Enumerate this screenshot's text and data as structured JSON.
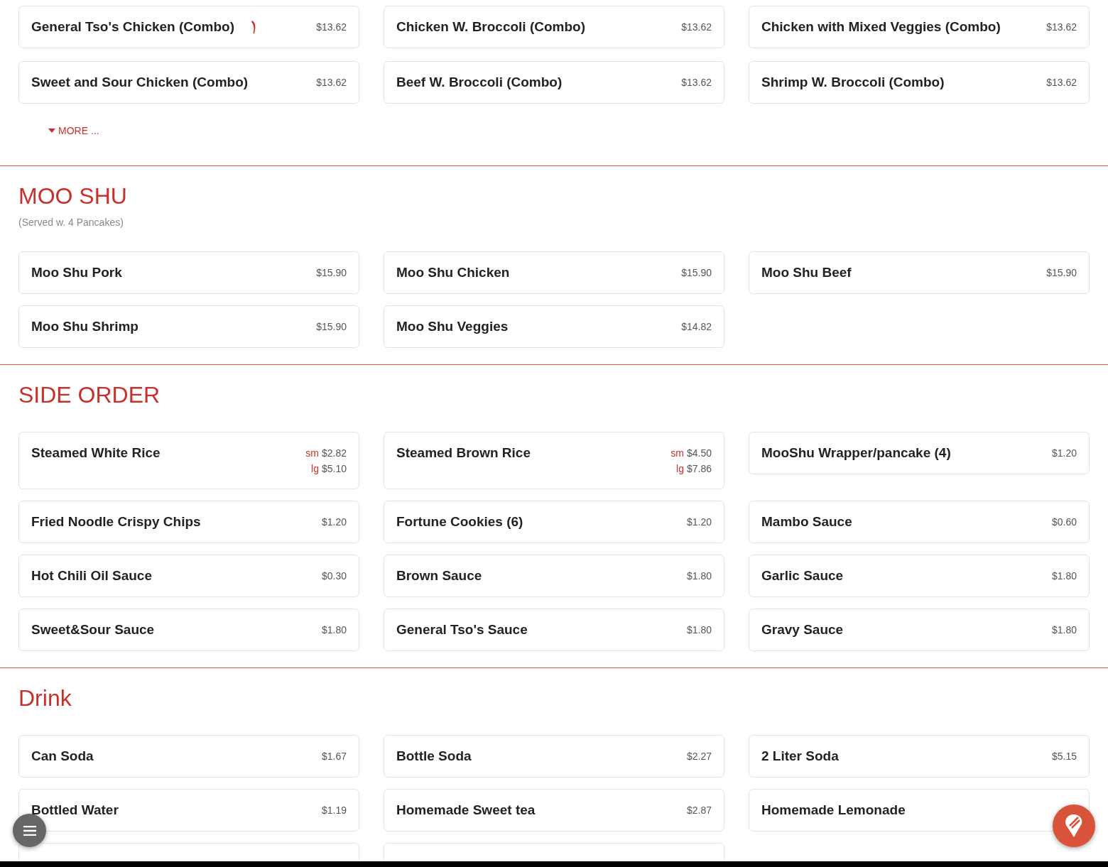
{
  "sections": [
    {
      "items": [
        {
          "name": "General Tso's Chicken (Combo)",
          "spicy": true,
          "prices": [
            {
              "price": "$13.62"
            }
          ]
        },
        {
          "name": "Chicken W. Broccoli (Combo)",
          "spicy": false,
          "prices": [
            {
              "price": "$13.62"
            }
          ]
        },
        {
          "name": "Chicken with Mixed Veggies (Combo)",
          "spicy": false,
          "prices": [
            {
              "price": "$13.62"
            }
          ]
        },
        {
          "name": "Sweet and Sour Chicken (Combo)",
          "spicy": false,
          "prices": [
            {
              "price": "$13.62"
            }
          ]
        },
        {
          "name": "Beef W. Broccoli (Combo)",
          "spicy": false,
          "prices": [
            {
              "price": "$13.62"
            }
          ]
        },
        {
          "name": "Shrimp W. Broccoli (Combo)",
          "spicy": false,
          "prices": [
            {
              "price": "$13.62"
            }
          ]
        }
      ],
      "more": "MORE ..."
    },
    {
      "title": "MOO SHU",
      "subtitle": "(Served w. 4 Pancakes)",
      "items": [
        {
          "name": "Moo Shu Pork",
          "spicy": false,
          "prices": [
            {
              "price": "$15.90"
            }
          ]
        },
        {
          "name": "Moo Shu Chicken",
          "spicy": false,
          "prices": [
            {
              "price": "$15.90"
            }
          ]
        },
        {
          "name": "Moo Shu Beef",
          "spicy": false,
          "prices": [
            {
              "price": "$15.90"
            }
          ]
        },
        {
          "name": "Moo Shu Shrimp",
          "spicy": false,
          "prices": [
            {
              "price": "$15.90"
            }
          ]
        },
        {
          "name": "Moo Shu Veggies",
          "spicy": false,
          "prices": [
            {
              "price": "$14.82"
            }
          ]
        }
      ]
    },
    {
      "title": "SIDE ORDER",
      "items": [
        {
          "name": "Steamed White Rice",
          "spicy": false,
          "prices": [
            {
              "size": "sm",
              "price": "$2.82"
            },
            {
              "size": "lg",
              "price": "$5.10"
            }
          ]
        },
        {
          "name": "Steamed Brown Rice",
          "spicy": false,
          "prices": [
            {
              "size": "sm",
              "price": "$4.50"
            },
            {
              "size": "lg",
              "price": "$7.86"
            }
          ]
        },
        {
          "name": "MooShu Wrapper/pancake (4)",
          "spicy": false,
          "prices": [
            {
              "price": "$1.20"
            }
          ]
        },
        {
          "name": "Fried Noodle Crispy Chips",
          "spicy": false,
          "prices": [
            {
              "price": "$1.20"
            }
          ]
        },
        {
          "name": "Fortune Cookies (6)",
          "spicy": false,
          "prices": [
            {
              "price": "$1.20"
            }
          ]
        },
        {
          "name": "Mambo Sauce",
          "spicy": false,
          "prices": [
            {
              "price": "$0.60"
            }
          ]
        },
        {
          "name": "Hot Chili Oil Sauce",
          "spicy": false,
          "prices": [
            {
              "price": "$0.30"
            }
          ]
        },
        {
          "name": "Brown Sauce",
          "spicy": false,
          "prices": [
            {
              "price": "$1.80"
            }
          ]
        },
        {
          "name": "Garlic Sauce",
          "spicy": false,
          "prices": [
            {
              "price": "$1.80"
            }
          ]
        },
        {
          "name": "Sweet&Sour Sauce",
          "spicy": false,
          "prices": [
            {
              "price": "$1.80"
            }
          ]
        },
        {
          "name": "General Tso's Sauce",
          "spicy": false,
          "prices": [
            {
              "price": "$1.80"
            }
          ]
        },
        {
          "name": "Gravy Sauce",
          "spicy": false,
          "prices": [
            {
              "price": "$1.80"
            }
          ]
        }
      ]
    },
    {
      "title": "Drink",
      "items": [
        {
          "name": "Can Soda",
          "spicy": false,
          "prices": [
            {
              "price": "$1.67"
            }
          ]
        },
        {
          "name": "Bottle Soda",
          "spicy": false,
          "prices": [
            {
              "price": "$2.27"
            }
          ]
        },
        {
          "name": "2 Liter Soda",
          "spicy": false,
          "prices": [
            {
              "price": "$5.15"
            }
          ]
        },
        {
          "name": "Bottled Water",
          "spicy": false,
          "prices": [
            {
              "price": "$1.19"
            }
          ]
        },
        {
          "name": "Homemade Sweet tea",
          "spicy": false,
          "prices": [
            {
              "price": "$2.87"
            }
          ]
        },
        {
          "name": "Homemade Lemonade",
          "spicy": false
        },
        {
          "spicy": false
        },
        {
          "spicy": false
        }
      ]
    }
  ]
}
